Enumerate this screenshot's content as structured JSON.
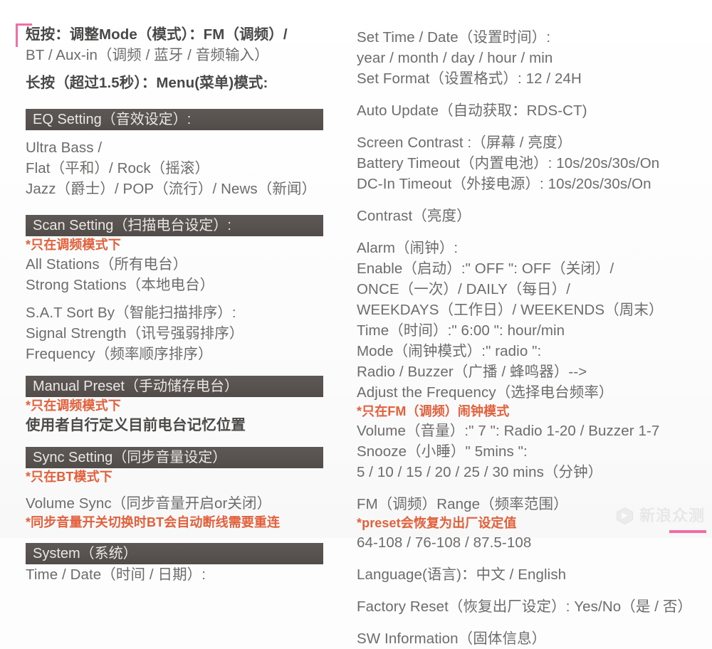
{
  "document": {
    "title": "短按：调整Mode（模式）：FM（调频）/",
    "accent_pink": "#ef6ca4",
    "note_color": "#e2603c",
    "header_bar_color": "#58534f",
    "body_text_color": "#6e6c6b"
  },
  "left_column": {
    "intro": {
      "lines": [
        "短按：调整Mode（模式）：FM（调频）/",
        "BT / Aux-in（调频 / 蓝牙 / 音频输入）"
      ],
      "long_press": "长按（超过1.5秒）：Menu(菜单)模式:"
    },
    "sections": [
      {
        "header": "EQ Setting（音效设定）:",
        "lines": [
          {
            "text": "Ultra Bass /",
            "style": "normal"
          },
          {
            "text": "Flat（平和）/ Rock（摇滚）",
            "style": "normal"
          },
          {
            "text": "Jazz（爵士）/ POP（流行）/ News（新闻）",
            "style": "normal"
          }
        ]
      },
      {
        "header": "Scan Setting（扫描电台设定）:",
        "lines": [
          {
            "text": "*只在调频模式下",
            "style": "note"
          },
          {
            "text": "All Stations（所有电台）",
            "style": "normal"
          },
          {
            "text": "Strong Stations（本地电台）",
            "style": "normal"
          },
          {
            "text": "",
            "style": "spacer"
          },
          {
            "text": "S.A.T Sort By（智能扫描排序）:",
            "style": "normal"
          },
          {
            "text": "Signal Strength（讯号强弱排序）",
            "style": "normal"
          },
          {
            "text": "Frequency（频率顺序排序）",
            "style": "normal"
          }
        ]
      },
      {
        "header": "Manual Preset（手动储存电台）",
        "lines": [
          {
            "text": "*只在调频模式下",
            "style": "note"
          },
          {
            "text": "使用者自行定义目前电台记忆位置",
            "style": "cn-bold"
          }
        ]
      },
      {
        "header": "Sync Setting（同步音量设定）",
        "lines": [
          {
            "text": "*只在BT模式下",
            "style": "note"
          },
          {
            "text": "Volume Sync（同步音量开启or关闭）",
            "style": "normal"
          },
          {
            "text": "*同步音量开关切换时BT会自动断线需要重连",
            "style": "note"
          }
        ]
      },
      {
        "header": "System（系统）",
        "lines": [
          {
            "text": "Time / Date（时间 / 日期）:",
            "style": "normal"
          }
        ]
      }
    ]
  },
  "right_column": {
    "groups": [
      {
        "lines": [
          "Set Time / Date（设置时间）:",
          "year / month / day / hour / min",
          "Set Format（设置格式）: 12 / 24H"
        ]
      },
      {
        "lines": [
          "Auto Update（自动获取：RDS-CT)"
        ]
      },
      {
        "lines": [
          "Screen Contrast :（屏幕 / 亮度）",
          "Battery Timeout（内置电池）: 10s/20s/30s/On",
          "DC-In Timeout（外接电源）: 10s/20s/30s/On"
        ]
      },
      {
        "lines": [
          "Contrast（亮度）"
        ]
      },
      {
        "lines": [
          "Alarm（闹钟）:",
          "Enable（启动）:\" OFF \": OFF（关闭）/",
          "ONCE（一次）/ DAILY（每日）/",
          "WEEKDAYS（工作日）/ WEEKENDS（周末）",
          "Time（时间）:\" 6:00 \": hour/min",
          "Mode（闹钟模式）:\" radio \":",
          "Radio / Buzzer（广播 / 蜂鸣器）-->",
          "Adjust the Frequency（选择电台频率）"
        ]
      },
      {
        "note": "*只在FM（调频）闹钟模式",
        "lines": [
          "Volume（音量）:\" 7 \": Radio 1-20 / Buzzer 1-7",
          "Snooze（小睡）\" 5mins \":",
          "5 / 10 / 15 / 20 / 25 / 30 mins（分钟）"
        ]
      },
      {
        "lines": [
          "FM（调频）Range（频率范围）"
        ],
        "note_after": "*preset会恢复为出厂设定值",
        "lines_after": [
          "64-108 / 76-108 / 87.5-108"
        ]
      },
      {
        "lines": [
          "Language(语言)：中文 / English"
        ]
      },
      {
        "lines": [
          "Factory Reset（恢复出厂设定）: Yes/No（是 / 否）"
        ]
      },
      {
        "lines": [
          "SW Information（固体信息）"
        ]
      }
    ]
  },
  "watermark": {
    "icon": "cube-icon",
    "text": "新浪众测"
  }
}
